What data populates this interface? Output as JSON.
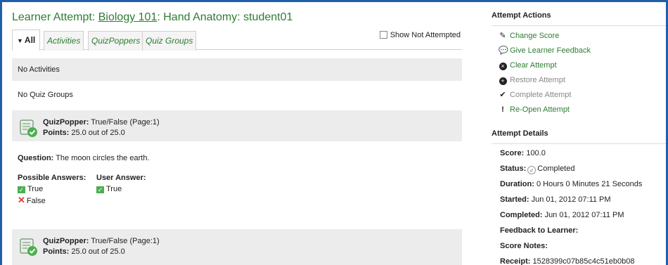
{
  "page": {
    "title_prefix": "Learner Attempt: ",
    "course_link": "Biology 101",
    "title_suffix": ": Hand Anatomy: student01"
  },
  "tabs": [
    {
      "label": "All",
      "active": true
    },
    {
      "label": "Activities"
    },
    {
      "label": "QuizPoppers"
    },
    {
      "label": "Quiz Groups"
    }
  ],
  "show_not_attempted": {
    "label": "Show Not Attempted",
    "checked": false
  },
  "sections": {
    "activities": "No Activities",
    "quiz_groups": "No Quiz Groups"
  },
  "quizpoppers": [
    {
      "type_label": "QuizPopper:",
      "type_value": "True/False",
      "page": "(Page:1)",
      "points_label": "Points:",
      "points_value": "25.0 out of 25.0",
      "question_label": "Question:",
      "question_text": "The moon circles the earth.",
      "possible_answers_label": "Possible Answers:",
      "user_answer_label": "User Answer:",
      "possible_answers": [
        {
          "text": "True",
          "correct": true
        },
        {
          "text": "False",
          "correct": false
        }
      ],
      "user_answer": "True"
    },
    {
      "type_label": "QuizPopper:",
      "type_value": "True/False",
      "page": "(Page:1)",
      "points_label": "Points:",
      "points_value": "25.0 out of 25.0"
    }
  ],
  "attempt_actions": {
    "heading": "Attempt Actions",
    "items": [
      {
        "label": "Change Score",
        "icon": "pencil-icon",
        "enabled": true
      },
      {
        "label": "Give Learner Feedback",
        "icon": "speech-bubble-icon",
        "enabled": true
      },
      {
        "label": "Clear Attempt",
        "icon": "x-circle-icon",
        "enabled": true
      },
      {
        "label": "Restore Attempt",
        "icon": "plus-circle-icon",
        "enabled": false
      },
      {
        "label": "Complete Attempt",
        "icon": "checkmark-icon",
        "enabled": false
      },
      {
        "label": "Re-Open Attempt",
        "icon": "exclamation-icon",
        "enabled": true
      }
    ]
  },
  "attempt_details": {
    "heading": "Attempt Details",
    "score_label": "Score:",
    "score_value": "100.0",
    "status_label": "Status:",
    "status_value": "Completed",
    "duration_label": "Duration:",
    "duration_value": "0 Hours 0 Minutes 21 Seconds",
    "started_label": "Started:",
    "started_value": "Jun 01, 2012 07:11 PM",
    "completed_label": "Completed:",
    "completed_value": "Jun 01, 2012 07:11 PM",
    "feedback_label": "Feedback to Learner:",
    "notes_label": "Score Notes:",
    "receipt_label": "Receipt:",
    "receipt_value": "1528399c07b85c4c51eb0b08"
  },
  "colors": {
    "accent_green": "#2e7d32",
    "frame_blue": "#1f5fa8",
    "band_gray": "#ececec",
    "correct_green": "#4caf50",
    "wrong_red": "#e53935"
  }
}
